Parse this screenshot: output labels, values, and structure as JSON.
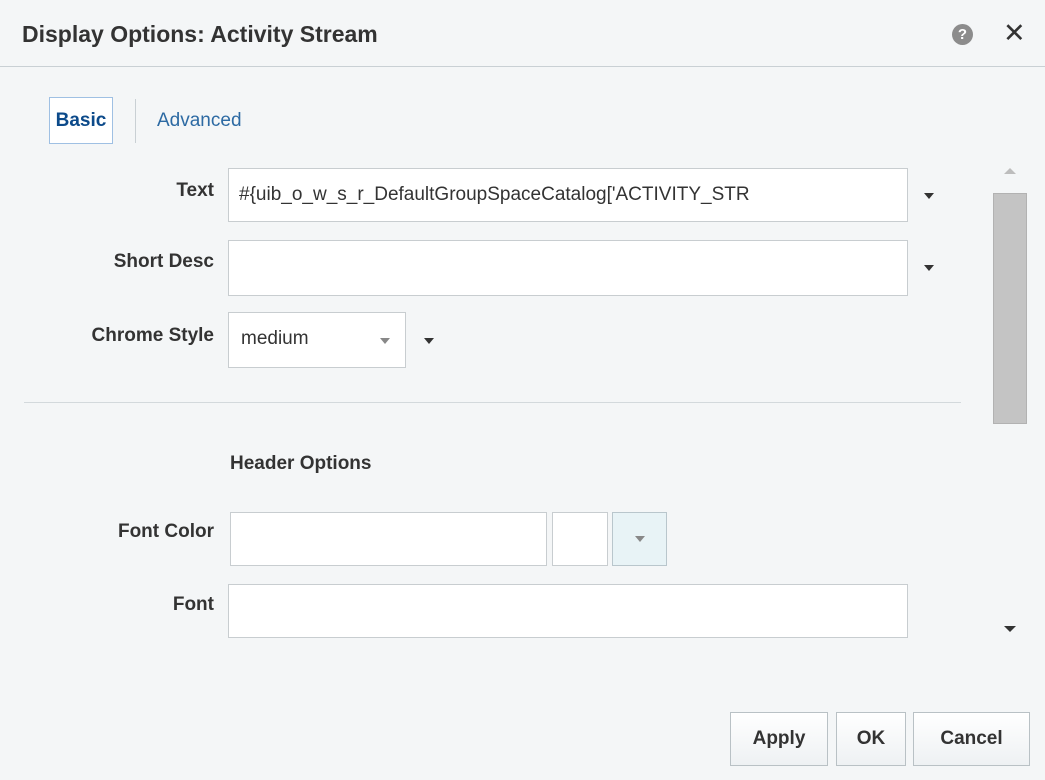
{
  "dialog": {
    "title": "Display Options: Activity Stream",
    "help_icon": "?",
    "close_icon": "✕"
  },
  "tabs": [
    {
      "label": "Basic",
      "selected": true
    },
    {
      "label": "Advanced",
      "selected": false
    }
  ],
  "fields": {
    "text": {
      "label": "Text",
      "value": "#{uib_o_w_s_r_DefaultGroupSpaceCatalog['ACTIVITY_STR"
    },
    "short_desc": {
      "label": "Short Desc",
      "value": ""
    },
    "chrome_style": {
      "label": "Chrome Style",
      "value": "medium"
    }
  },
  "header_options": {
    "heading": "Header Options",
    "font_color": {
      "label": "Font Color",
      "value": ""
    },
    "font": {
      "label": "Font",
      "value": ""
    }
  },
  "buttons": {
    "apply": "Apply",
    "ok": "OK",
    "cancel": "Cancel"
  },
  "colors": {
    "background": "#f4f6f7",
    "selected_tab_text": "#0c4a8a",
    "link_text": "#2d6aa3"
  }
}
